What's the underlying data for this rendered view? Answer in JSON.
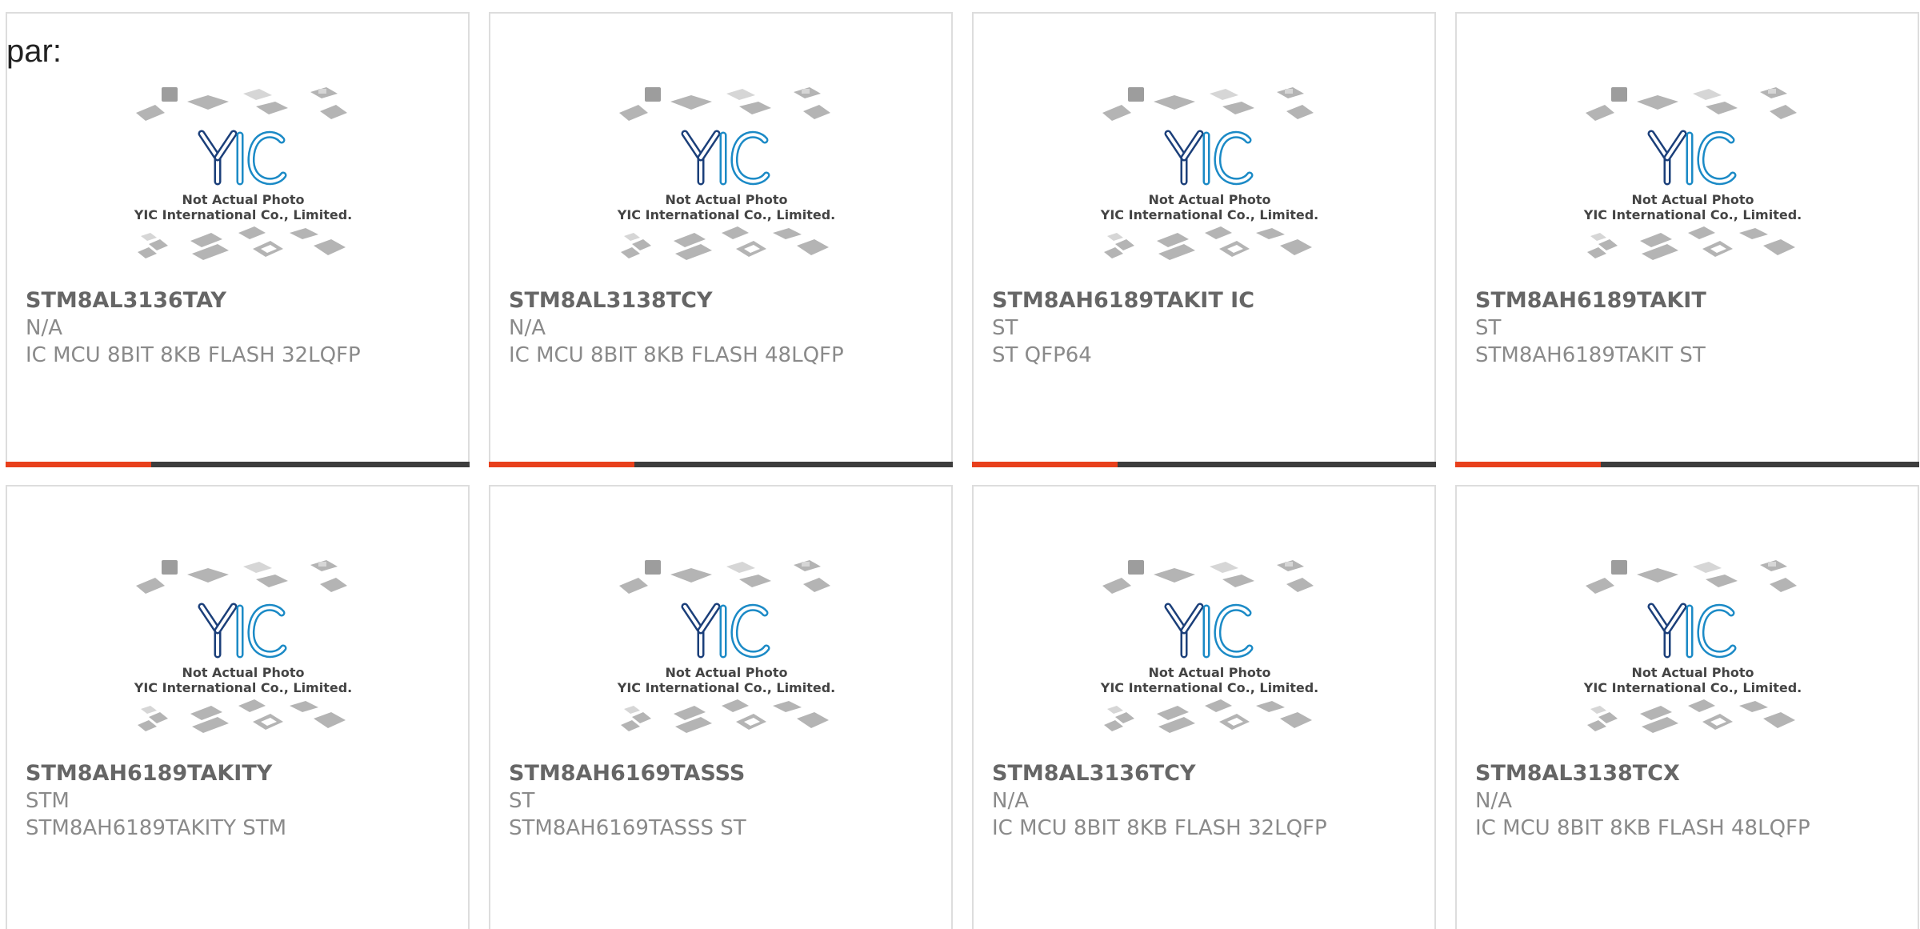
{
  "heading": "par:",
  "colors": {
    "accent": "#e8401c",
    "bar": "#3d3d3d",
    "logo_blue": "#1b8ac6",
    "logo_dark": "#1b3f7a"
  },
  "thumbnail": {
    "logo_text": "YIC",
    "caption_line1": "Not Actual Photo",
    "caption_line2": "YIC International Co., Limited."
  },
  "products": [
    {
      "part": "STM8AL3136TAY",
      "manufacturer": "N/A",
      "description": "IC MCU 8BIT 8KB FLASH 32LQFP"
    },
    {
      "part": "STM8AL3138TCY",
      "manufacturer": "N/A",
      "description": "IC MCU 8BIT 8KB FLASH 48LQFP"
    },
    {
      "part": "STM8AH6189TAKIT IC",
      "manufacturer": "ST",
      "description": "ST QFP64"
    },
    {
      "part": "STM8AH6189TAKIT",
      "manufacturer": "ST",
      "description": "STM8AH6189TAKIT ST"
    },
    {
      "part": "STM8AH6189TAKITY",
      "manufacturer": "STM",
      "description": "STM8AH6189TAKITY STM"
    },
    {
      "part": "STM8AH6169TASSS",
      "manufacturer": "ST",
      "description": "STM8AH6169TASSS ST"
    },
    {
      "part": "STM8AL3136TCY",
      "manufacturer": "N/A",
      "description": "IC MCU 8BIT 8KB FLASH 32LQFP"
    },
    {
      "part": "STM8AL3138TCX",
      "manufacturer": "N/A",
      "description": "IC MCU 8BIT 8KB FLASH 48LQFP"
    }
  ]
}
